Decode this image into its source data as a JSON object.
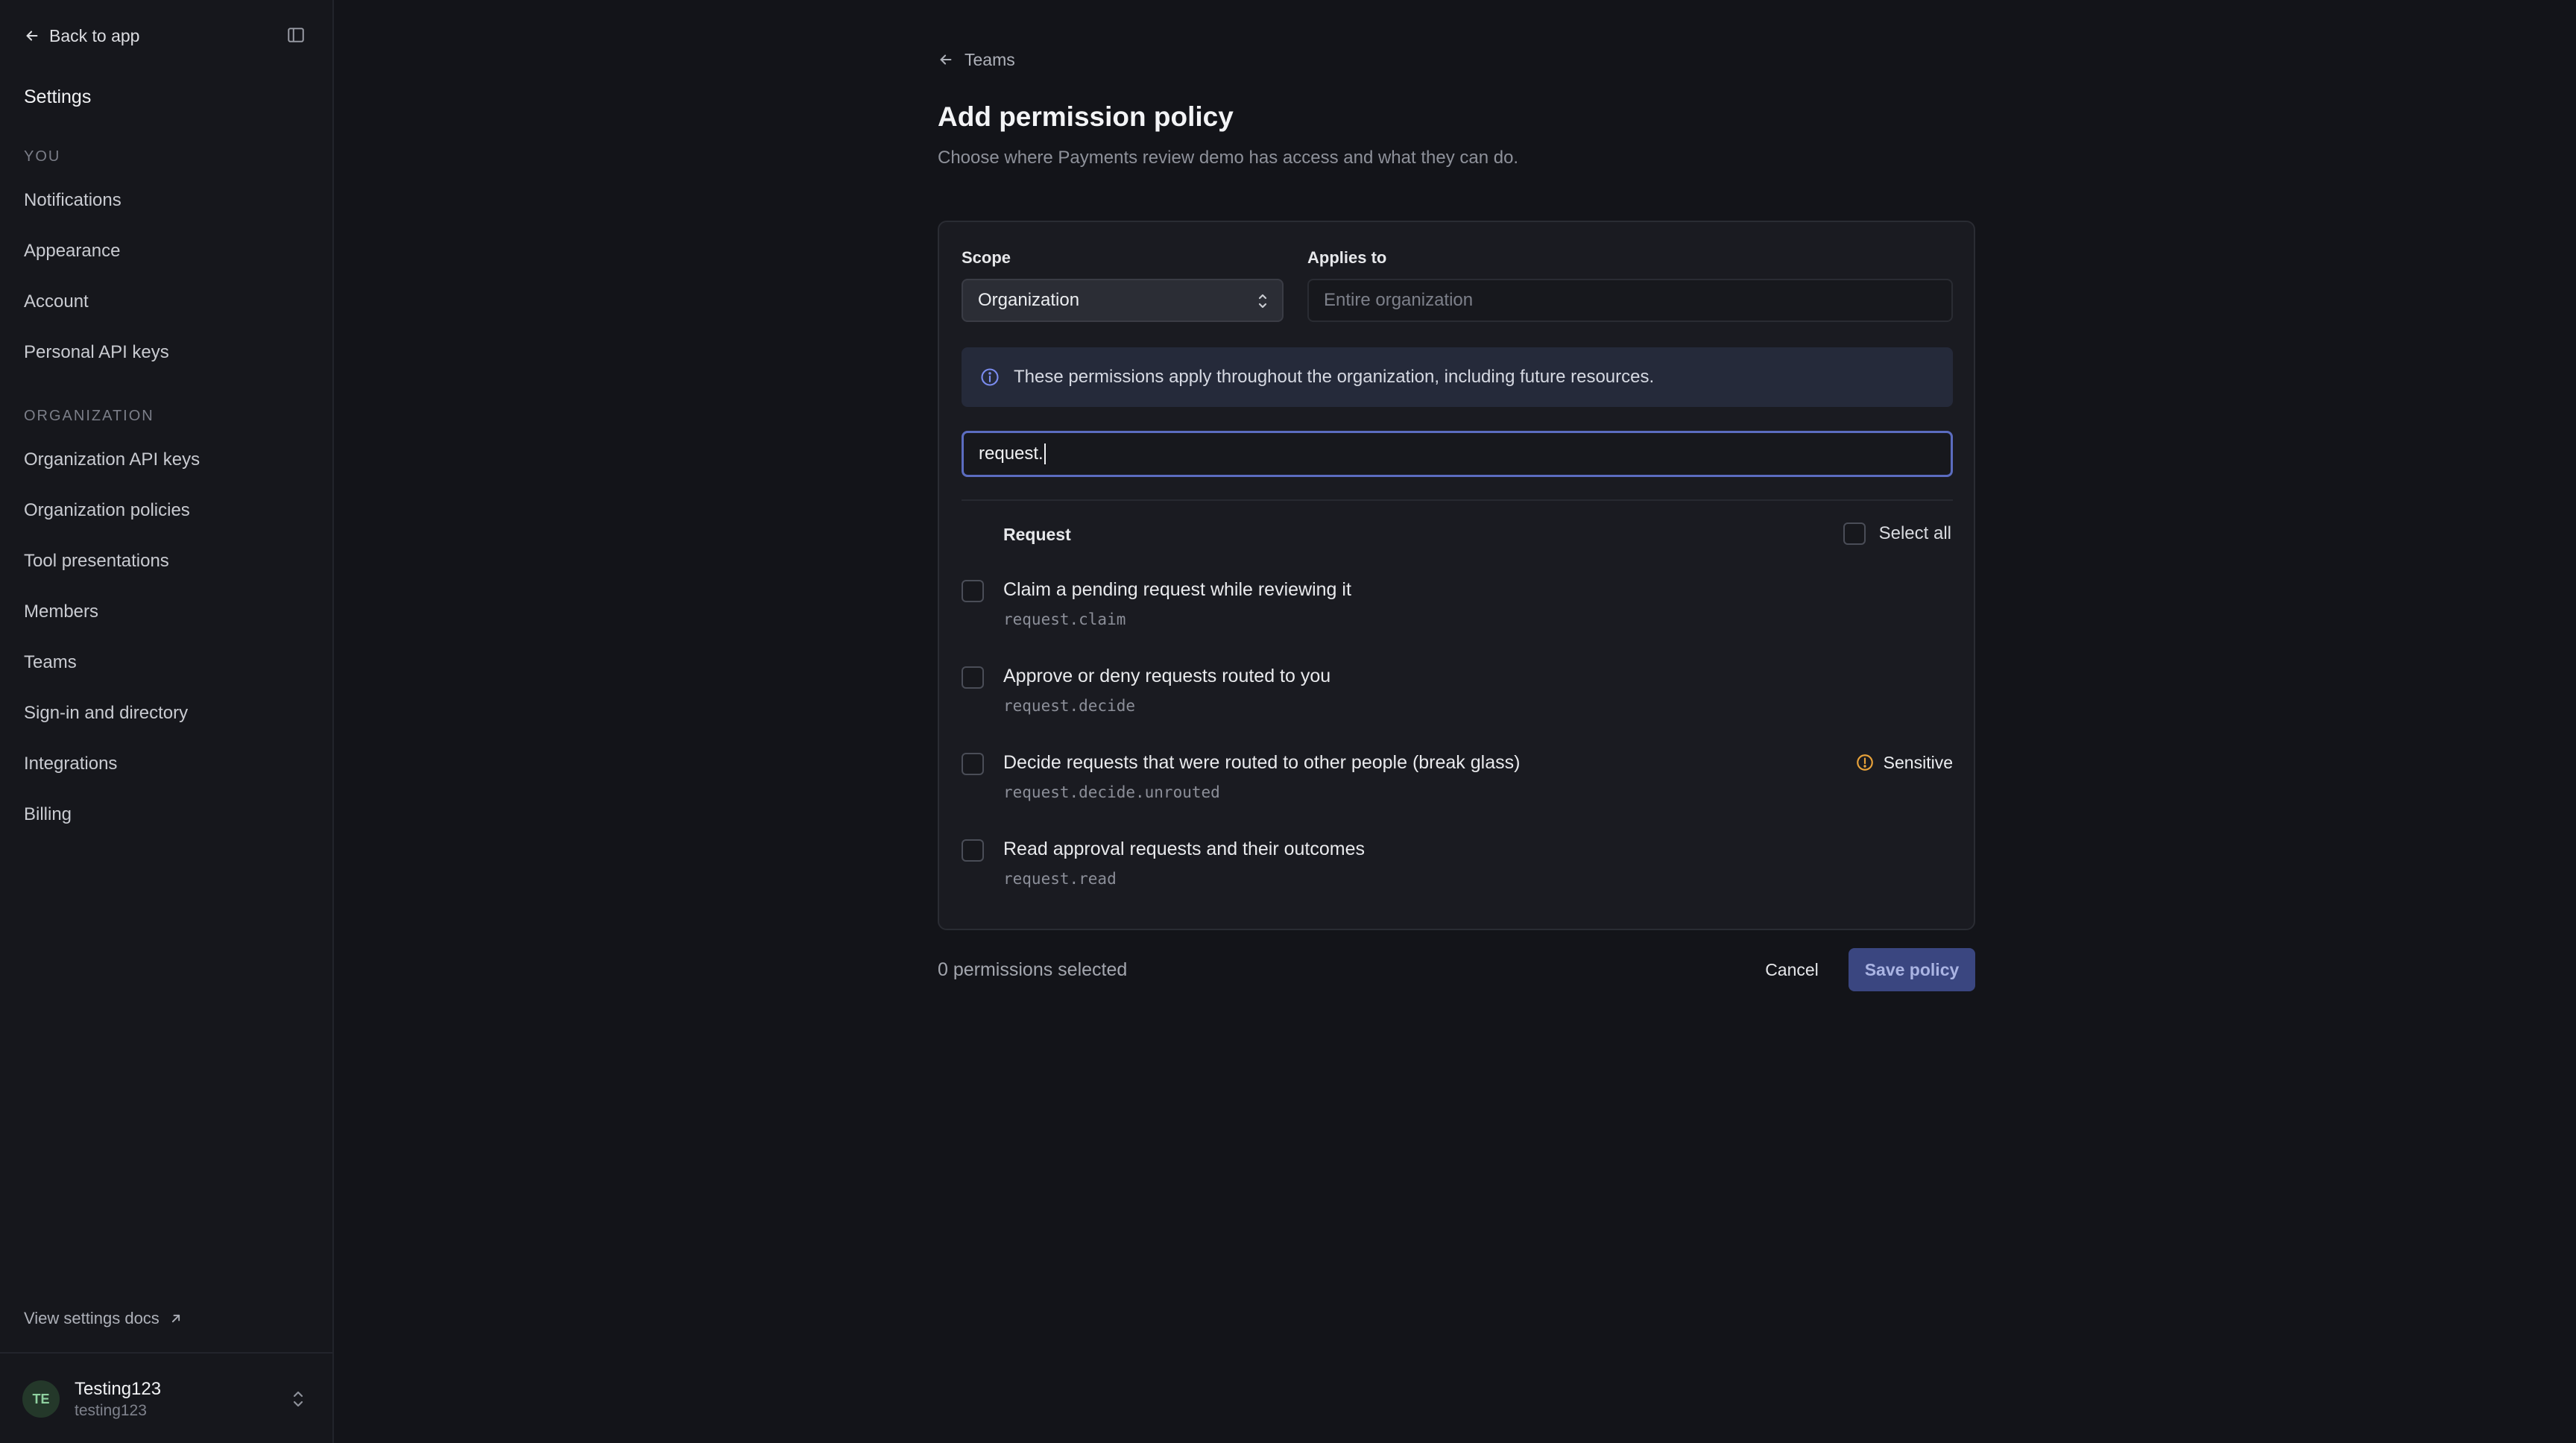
{
  "sidebar": {
    "back_label": "Back to app",
    "title": "Settings",
    "sections": [
      {
        "label": "YOU",
        "items": [
          "Notifications",
          "Appearance",
          "Account",
          "Personal API keys"
        ]
      },
      {
        "label": "ORGANIZATION",
        "items": [
          "Organization API keys",
          "Organization policies",
          "Tool presentations",
          "Members",
          "Teams",
          "Sign-in and directory",
          "Integrations",
          "Billing"
        ]
      }
    ],
    "docs_link": "View settings docs",
    "user": {
      "initials": "TE",
      "name": "Testing123",
      "handle": "testing123"
    }
  },
  "header": {
    "breadcrumb": "Teams",
    "title": "Add permission policy",
    "subtitle": "Choose where Payments review demo has access and what they can do."
  },
  "form": {
    "scope_label": "Scope",
    "scope_value": "Organization",
    "applies_label": "Applies to",
    "applies_placeholder": "Entire organization",
    "info_text": "These permissions apply throughout the organization, including future resources.",
    "search_value": "request.",
    "group_label": "Request",
    "select_all_label": "Select all",
    "permissions": [
      {
        "title": "Claim a pending request while reviewing it",
        "code": "request.claim",
        "sensitive": false,
        "checked": false
      },
      {
        "title": "Approve or deny requests routed to you",
        "code": "request.decide",
        "sensitive": false,
        "checked": false
      },
      {
        "title": "Decide requests that were routed to other people (break glass)",
        "code": "request.decide.unrouted",
        "sensitive": true,
        "checked": false
      },
      {
        "title": "Read approval requests and their outcomes",
        "code": "request.read",
        "sensitive": false,
        "checked": false
      }
    ],
    "sensitive_label": "Sensitive"
  },
  "footer": {
    "selected_count": "0 permissions selected",
    "cancel_label": "Cancel",
    "save_label": "Save policy"
  },
  "colors": {
    "accent": "#5b6cc0",
    "warning": "#e8a23a",
    "info": "#7b8cf0"
  }
}
